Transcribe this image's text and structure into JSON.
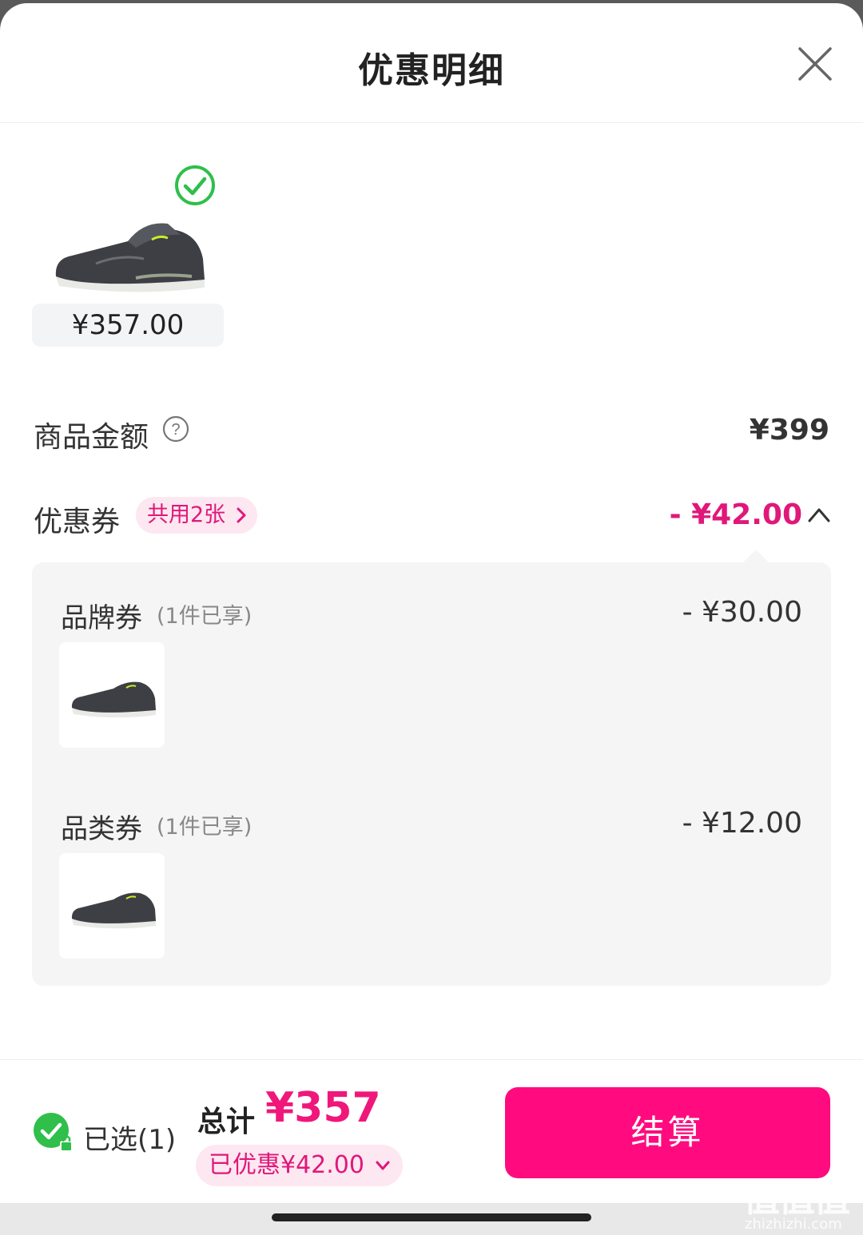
{
  "header": {
    "title": "优惠明细",
    "close_icon": "close-icon"
  },
  "product": {
    "price": "¥357.00",
    "selected": true
  },
  "subtotal": {
    "label": "商品金额",
    "value": "¥399"
  },
  "coupons": {
    "label": "优惠券",
    "badge": "共用2张",
    "total": "- ¥42.00",
    "items": [
      {
        "name": "品牌券",
        "note": "(1件已享)",
        "amount": "- ¥30.00"
      },
      {
        "name": "品类券",
        "note": "(1件已享)",
        "amount": "- ¥12.00"
      }
    ]
  },
  "bottom_bar": {
    "selected_text": "已选(1)",
    "total_label": "总计",
    "total_value": "¥357",
    "discount_pill": "已优惠¥42.00",
    "checkout_label": "结算"
  },
  "colors": {
    "accent": "#ff0b7f",
    "accent_text": "#e0187a",
    "check_green": "#2fbf4a"
  },
  "watermark": {
    "main": "值值值",
    "sub": "zhizhizhi.com"
  }
}
